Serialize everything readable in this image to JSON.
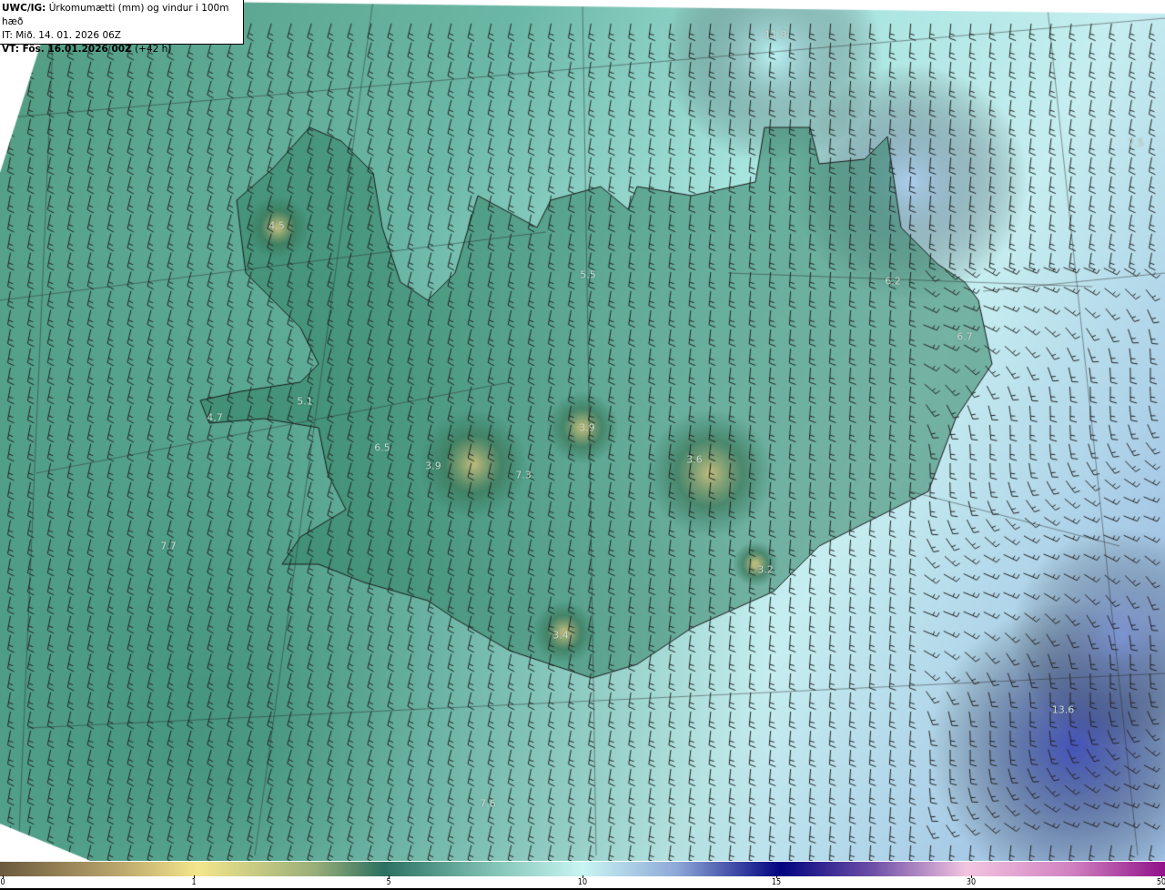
{
  "header": {
    "model": "UWC/IG:",
    "title": "Úrkomumætti (mm) og vindur i 100m hæð",
    "init": "IT: Mið. 14. 01. 2026 06Z",
    "valid_label": "VT: Fös. 16.01.2026 00Z",
    "lead": "(+42 h)"
  },
  "map_labels": [
    "11.8",
    "7.5",
    "4.5",
    "5.5",
    "6.2",
    "6.7",
    "5.1",
    "4.7",
    "6.5",
    "3.9",
    "3.9",
    "7.3",
    "3.6",
    "7.7",
    "3.2",
    "3.4",
    "13.6",
    "7.6"
  ],
  "colorbar": {
    "ticks": [
      "0",
      "1",
      "5",
      "10",
      "15",
      "30",
      "50"
    ],
    "colors": [
      "#6b5a3e",
      "#f4e68c",
      "#2b7060",
      "#c9f5f3",
      "#020480",
      "#f4c4e0",
      "#90128a"
    ]
  }
}
